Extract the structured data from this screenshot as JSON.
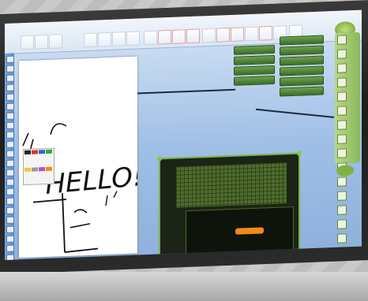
{
  "window": {
    "title": ""
  },
  "ribbon": {
    "tabs": [
      "",
      "",
      "",
      "",
      "",
      "",
      "",
      ""
    ]
  },
  "menu_left": {
    "items": [
      "",
      "",
      "",
      ""
    ]
  },
  "menu_right": {
    "items": [
      "",
      "",
      "",
      "",
      "",
      ""
    ]
  },
  "canvas": {
    "handwriting": "HELLO!"
  },
  "game": {
    "prompt": "",
    "description": "",
    "button": "",
    "score_label": "",
    "time_label": "",
    "footer_label": ""
  },
  "colors": {
    "menu_green": "#3c6f28",
    "dock_green": "#8ab85a",
    "game_border": "#7db341",
    "accent_orange": "#f08a1e"
  }
}
